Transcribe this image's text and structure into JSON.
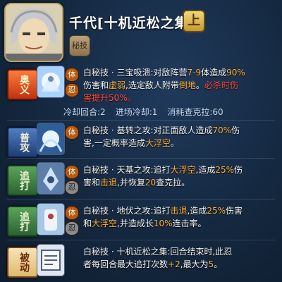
{
  "header": {
    "title": "千代[十机近松之集]",
    "grade": "上",
    "type_badge": "秘技"
  },
  "skills": [
    {
      "label": "奥义",
      "chakra_mark": "体",
      "second_mark": "忍",
      "line1_a": "白秘技 · 三宝吸溃:对敌阵营",
      "line1_hl": "7-9",
      "line1_b": "体造成",
      "line1_hl2": "90%",
      "line2_a": "伤害和",
      "line2_hl": "虚弱",
      "line2_b": ",选定敌人附带",
      "line2_hl2": "倒地",
      "line2_c": "。",
      "line2_hl3": "必杀时伤",
      "line3": "害提升50%。"
    },
    {
      "label": "普攻",
      "chakra_mark": "体",
      "line1_a": "白秘技 · 基转之攻:对正面敌人造成",
      "line1_hl": "70%",
      "line1_b": "伤",
      "line2_a": "害,一定概率造成",
      "line2_hl": "大浮空",
      "line2_b": "。"
    },
    {
      "label": "追打",
      "chakra_mark": "体",
      "second_mark": "忍",
      "line1_a": "白秘技 · 天基之攻:追打",
      "line1_hl": "大浮空",
      "line1_b": ",造成",
      "line1_hl2": "25%",
      "line1_c": "伤",
      "line2_a": "害和",
      "line2_hl": "击退",
      "line2_b": ",并恢复",
      "line2_hl2": "20",
      "line2_c": "查克拉。"
    },
    {
      "label": "追打",
      "chakra_mark": "体",
      "second_mark": "忍",
      "line1_a": "白秘技 · 地伏之攻:追打",
      "line1_hl": "击退",
      "line1_b": ",造成",
      "line1_hl2": "25%",
      "line1_c": "伤害",
      "line2_a": "和",
      "line2_hl": "大浮空",
      "line2_b": ",并造成长",
      "line2_hl2": "10%",
      "line2_c": "连击率。"
    },
    {
      "label": "被动",
      "line1_a": "白秘技 · 十机近松之集:回合结束时,此忍",
      "line2_a": "者每回合最大追打次数",
      "line2_hl": "+2",
      "line2_b": ",最大为",
      "line2_hl2": "5",
      "line2_c": "。"
    }
  ],
  "stats": {
    "cooldown": "冷却回合:2",
    "entry_cd": "进场冷却:1",
    "chakra_cost": "消耗查克拉:60"
  }
}
